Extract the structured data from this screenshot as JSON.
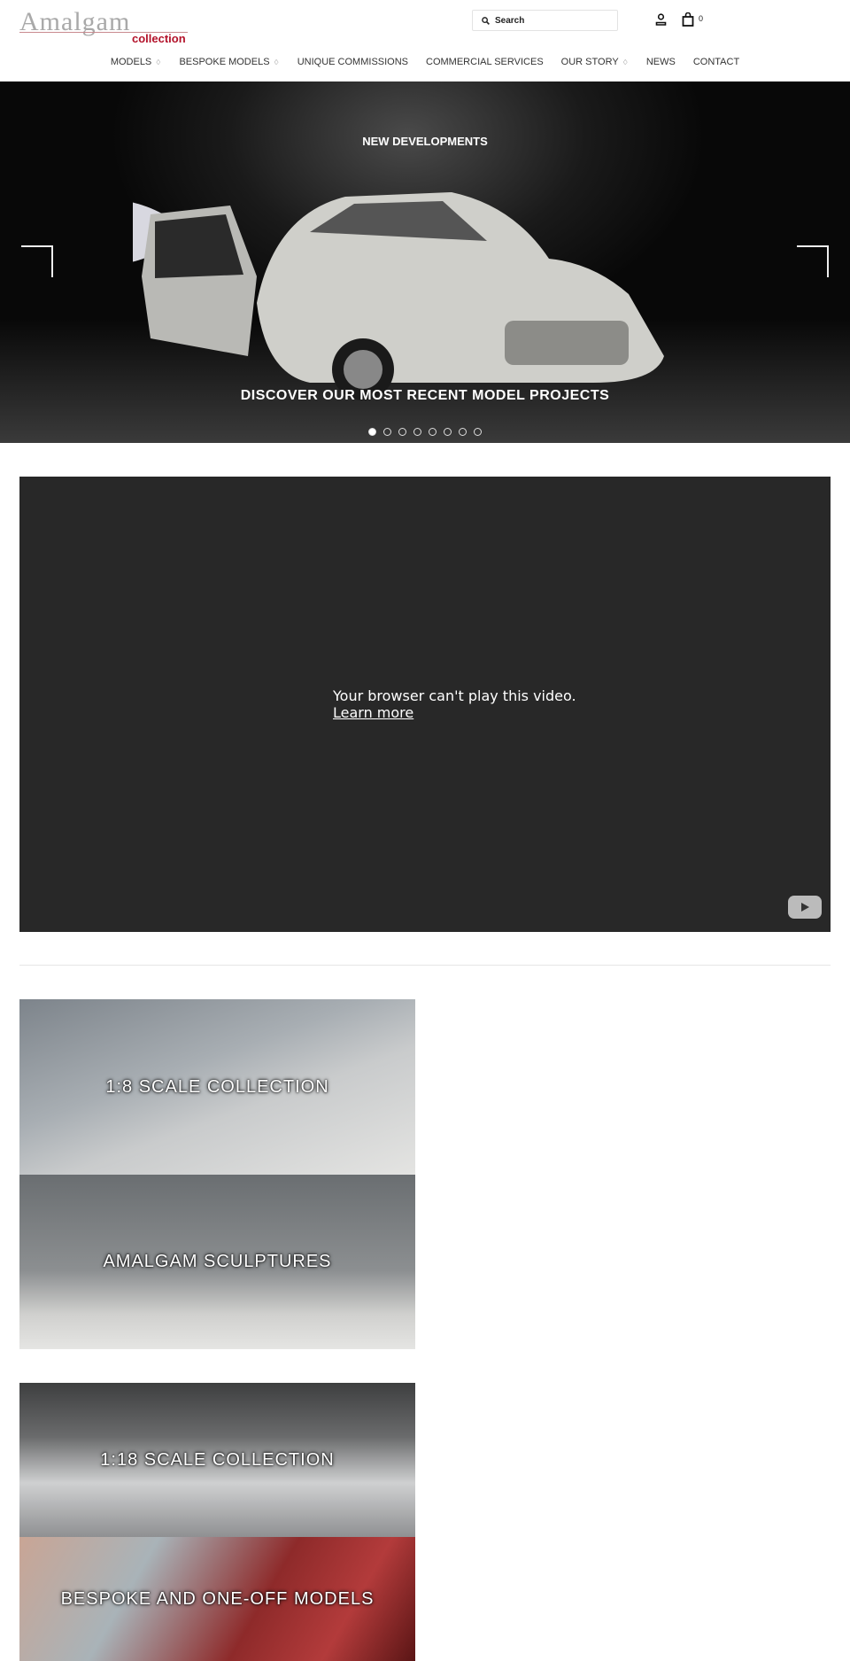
{
  "header": {
    "logo_main": "Amalgam",
    "logo_sub": "collection",
    "search_placeholder": "Search",
    "cart_count": "0"
  },
  "nav": [
    {
      "label": "MODELS",
      "dropdown": true
    },
    {
      "label": "BESPOKE MODELS",
      "dropdown": true
    },
    {
      "label": "UNIQUE COMMISSIONS",
      "dropdown": false
    },
    {
      "label": "COMMERCIAL SERVICES",
      "dropdown": false
    },
    {
      "label": "OUR STORY",
      "dropdown": true
    },
    {
      "label": "NEWS",
      "dropdown": false
    },
    {
      "label": "CONTACT",
      "dropdown": false
    }
  ],
  "hero": {
    "kicker": "NEW DEVELOPMENTS",
    "caption": "DISCOVER OUR MOST RECENT MODEL PROJECTS",
    "slides": 8,
    "active_slide": 1
  },
  "video": {
    "message": "Your browser can't play this video.",
    "link": "Learn more"
  },
  "tiles": [
    {
      "label": "1:8 SCALE COLLECTION"
    },
    {
      "label": "AMALGAM SCULPTURES"
    },
    {
      "label": "1:18 SCALE COLLECTION"
    },
    {
      "label": "BESPOKE AND ONE-OFF MODELS"
    }
  ],
  "colors": {
    "brand_red": "#b3122a",
    "video_bg": "#282828"
  }
}
